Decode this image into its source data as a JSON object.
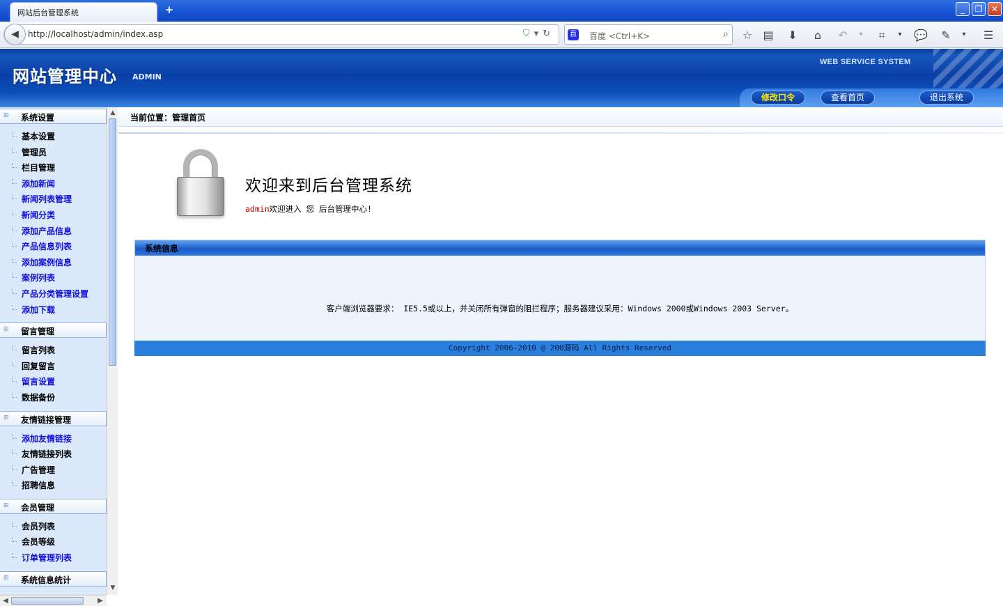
{
  "browser": {
    "tab_title": "网站后台管理系统",
    "new_tab": "+",
    "url": "http://localhost/admin/index.asp",
    "search_engine": "百",
    "search_placeholder": "百度 <Ctrl+K>",
    "window_buttons": [
      "_",
      "❐",
      "✕"
    ]
  },
  "header": {
    "logo": "网站管理中心",
    "logo_sub": "ADMIN",
    "tagline": "WEB SERVICE SYSTEM",
    "buttons": [
      {
        "label": "修改口令"
      },
      {
        "label": "查看首页"
      },
      {
        "label": "退出系统"
      }
    ]
  },
  "sidebar": {
    "groups": [
      {
        "title": "系统设置",
        "items": [
          {
            "label": "基本设置",
            "color": "dark"
          },
          {
            "label": "管理员",
            "color": "dark"
          },
          {
            "label": "栏目管理",
            "color": "dark"
          },
          {
            "label": "添加新闻",
            "color": "blue"
          },
          {
            "label": "新闻列表管理",
            "color": "blue"
          },
          {
            "label": "新闻分类",
            "color": "blue"
          },
          {
            "label": "添加产品信息",
            "color": "blue"
          },
          {
            "label": "产品信息列表",
            "color": "blue"
          },
          {
            "label": "添加案例信息",
            "color": "blue"
          },
          {
            "label": "案例列表",
            "color": "blue"
          },
          {
            "label": "产品分类管理设置",
            "color": "blue"
          },
          {
            "label": "添加下载",
            "color": "blue"
          }
        ]
      },
      {
        "title": "留言管理",
        "items": [
          {
            "label": "留言列表",
            "color": "dark"
          },
          {
            "label": "回复留言",
            "color": "dark"
          },
          {
            "label": "留言设置",
            "color": "blue"
          },
          {
            "label": "数据备份",
            "color": "dark"
          }
        ]
      },
      {
        "title": "友情链接管理",
        "items": [
          {
            "label": "添加友情链接",
            "color": "blue"
          },
          {
            "label": "友情链接列表",
            "color": "dark"
          },
          {
            "label": "广告管理",
            "color": "dark"
          },
          {
            "label": "招聘信息",
            "color": "dark"
          }
        ]
      },
      {
        "title": "会员管理",
        "items": [
          {
            "label": "会员列表",
            "color": "dark"
          },
          {
            "label": "会员等级",
            "color": "dark"
          },
          {
            "label": "订单管理列表",
            "color": "blue"
          }
        ]
      },
      {
        "title": "系统信息统计",
        "items": []
      }
    ]
  },
  "main": {
    "crumb": "当前位置：管理首页",
    "welcome_title": "欢迎来到后台管理系统",
    "welcome_user": "admin",
    "welcome_rest": "欢迎进入 您 后台管理中心!",
    "panel_title": "系统信息",
    "panel_text": "客户端浏览器要求： IE5.5或以上，并关闭所有弹窗的阻拦程序；服务器建议采用：Windows 2000或Windows 2003 Server。",
    "copyright": "Copyright 2006-2010 @ 200源码 All Rights Reserved"
  }
}
